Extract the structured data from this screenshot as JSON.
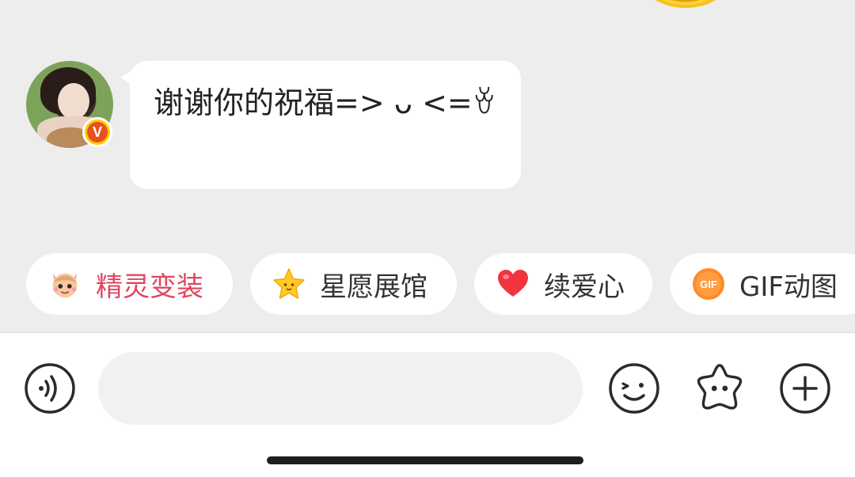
{
  "chat": {
    "messages": [
      {
        "sender": "contact",
        "text": "谢谢你的祝福=> ᴗ <=ꈊ",
        "verified_badge": "V"
      }
    ]
  },
  "quick_actions": [
    {
      "label": "精灵变装",
      "icon": "elf-avatar-icon",
      "accent": "#e0465f"
    },
    {
      "label": "星愿展馆",
      "icon": "star-icon",
      "accent": "#333333"
    },
    {
      "label": "续爱心",
      "icon": "heart-icon",
      "accent": "#333333"
    },
    {
      "label": "GIF动图",
      "icon": "gif-icon",
      "accent": "#333333",
      "icon_text": "GIF"
    }
  ],
  "composer": {
    "placeholder": "",
    "value": "",
    "voice_icon": "voice-icon",
    "emoji_icon": "emoji-icon",
    "sticker_icon": "sticker-star-icon",
    "more_icon": "plus-icon"
  },
  "colors": {
    "chat_background": "#ededed",
    "bubble": "#ffffff",
    "pink_accent": "#e0465f",
    "badge_orange": "#e8511b",
    "badge_yellow": "#ffcc00"
  }
}
